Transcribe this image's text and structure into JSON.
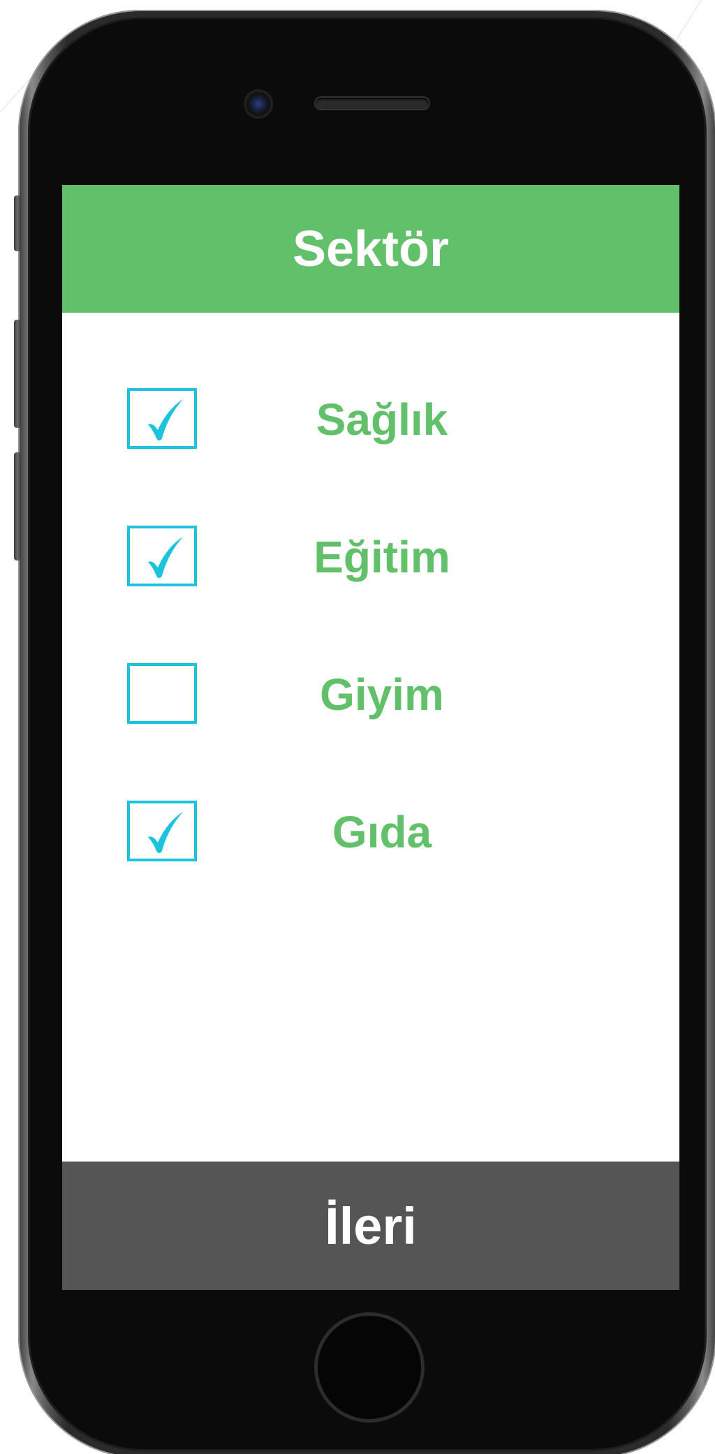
{
  "header": {
    "title": "Sektör",
    "background_color": "#63c06a"
  },
  "options": [
    {
      "label": "Sağlık",
      "checked": true
    },
    {
      "label": "Eğitim",
      "checked": true
    },
    {
      "label": "Giyim",
      "checked": false
    },
    {
      "label": "Gıda",
      "checked": true
    }
  ],
  "footer": {
    "next_label": "İleri",
    "background_color": "#555555"
  },
  "colors": {
    "accent_green": "#63c06a",
    "checkbox_cyan": "#1bc3dc"
  },
  "icons": {
    "checkmark": "check-icon"
  }
}
